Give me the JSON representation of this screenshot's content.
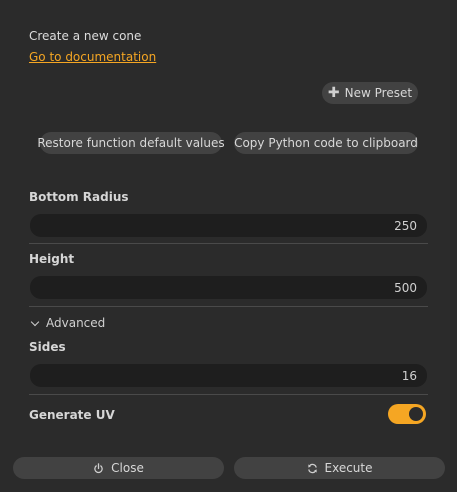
{
  "header": {
    "description": "Create a new cone",
    "doc_link": "Go to documentation"
  },
  "toolbar": {
    "new_preset_label": "New Preset",
    "restore_label": "Restore function default values",
    "copy_python_label": "Copy Python code to clipboard"
  },
  "fields": {
    "bottom_radius": {
      "label": "Bottom Radius",
      "value": "250"
    },
    "height": {
      "label": "Height",
      "value": "500"
    },
    "advanced_label": "Advanced",
    "sides": {
      "label": "Sides",
      "value": "16"
    },
    "generate_uv": {
      "label": "Generate UV",
      "checked": true
    }
  },
  "footer": {
    "close_label": "Close",
    "execute_label": "Execute"
  },
  "colors": {
    "accent": "#f5a623",
    "background": "#2b2b2b",
    "field_background": "#1e1e1e",
    "button_background": "#424242"
  },
  "icons": {
    "new_preset": "plus-icon",
    "advanced": "chevron-down-icon",
    "close": "power-icon",
    "execute": "refresh-icon"
  }
}
